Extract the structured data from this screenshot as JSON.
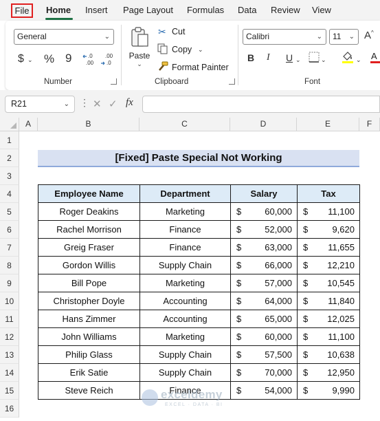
{
  "menu": {
    "items": [
      "File",
      "Home",
      "Insert",
      "Page Layout",
      "Formulas",
      "Data",
      "Review",
      "View"
    ]
  },
  "ribbon": {
    "number": {
      "format_value": "General",
      "currency_symbol": "$",
      "percent_symbol": "%",
      "comma_symbol": "9",
      "increase_decimal_label": ".00",
      "decrease_decimal_label": ".00",
      "group_label": "Number"
    },
    "clipboard": {
      "paste_label": "Paste",
      "cut_label": "Cut",
      "copy_label": "Copy",
      "format_painter_label": "Format Painter",
      "group_label": "Clipboard"
    },
    "font": {
      "font_name": "Calibri",
      "font_size": "11",
      "bold_label": "B",
      "italic_label": "I",
      "underline_label": "U",
      "group_label": "Font"
    }
  },
  "formula_bar": {
    "name_box": "R21",
    "fx_label": "fx",
    "formula": ""
  },
  "grid": {
    "columns": [
      "A",
      "B",
      "C",
      "D",
      "E",
      "F"
    ],
    "rows": [
      "1",
      "2",
      "3",
      "4",
      "5",
      "6",
      "7",
      "8",
      "9",
      "10",
      "11",
      "12",
      "13",
      "14",
      "15",
      "16"
    ]
  },
  "sheet": {
    "title": "[Fixed] Paste Special Not Working",
    "headers": [
      "Employee Name",
      "Department",
      "Salary",
      "Tax"
    ],
    "currency": "$",
    "rows": [
      {
        "name": "Roger Deakins",
        "dept": "Marketing",
        "salary": "60,000",
        "tax": "11,100"
      },
      {
        "name": "Rachel Morrison",
        "dept": "Finance",
        "salary": "52,000",
        "tax": "9,620"
      },
      {
        "name": "Greig Fraser",
        "dept": "Finance",
        "salary": "63,000",
        "tax": "11,655"
      },
      {
        "name": "Gordon Willis",
        "dept": "Supply Chain",
        "salary": "66,000",
        "tax": "12,210"
      },
      {
        "name": "Bill Pope",
        "dept": "Marketing",
        "salary": "57,000",
        "tax": "10,545"
      },
      {
        "name": "Christopher Doyle",
        "dept": "Accounting",
        "salary": "64,000",
        "tax": "11,840"
      },
      {
        "name": "Hans Zimmer",
        "dept": "Accounting",
        "salary": "65,000",
        "tax": "12,025"
      },
      {
        "name": "John Williams",
        "dept": "Marketing",
        "salary": "60,000",
        "tax": "11,100"
      },
      {
        "name": "Philip Glass",
        "dept": "Supply Chain",
        "salary": "57,500",
        "tax": "10,638"
      },
      {
        "name": "Erik Satie",
        "dept": "Supply Chain",
        "salary": "70,000",
        "tax": "12,950"
      },
      {
        "name": "Steve Reich",
        "dept": "Finance",
        "salary": "54,000",
        "tax": "9,990"
      }
    ]
  },
  "watermark": {
    "name": "exceldemy",
    "tagline": "EXCEL · DATA · BI"
  },
  "colors": {
    "accent": "#1e7145",
    "title_fill": "#d9e1f2",
    "header_fill": "#ddebf7",
    "file_highlight": "#e02020"
  }
}
